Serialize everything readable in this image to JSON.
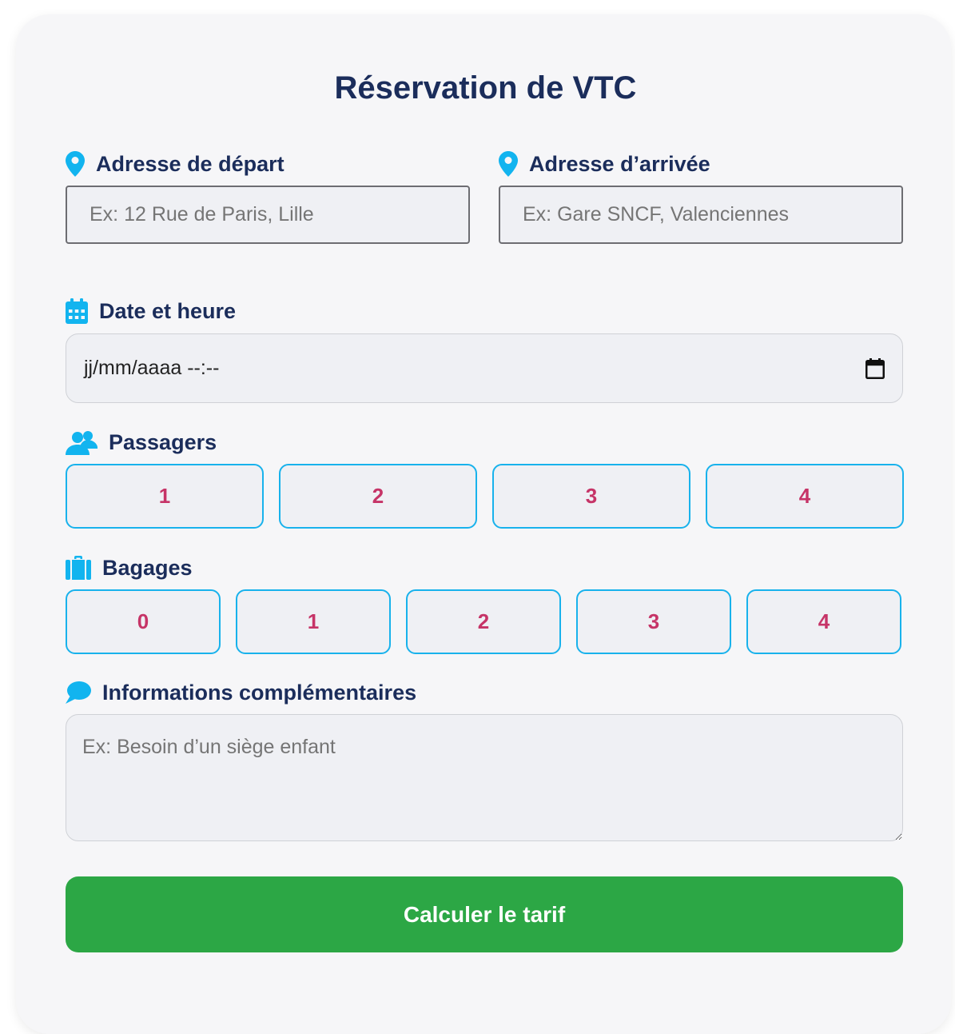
{
  "form": {
    "title": "Réservation de VTC",
    "departure": {
      "label": "Adresse de départ",
      "placeholder": "Ex: 12 Rue de Paris, Lille",
      "value": ""
    },
    "arrival": {
      "label": "Adresse d’arrivée",
      "placeholder": "Ex: Gare SNCF, Valenciennes",
      "value": ""
    },
    "datetime": {
      "label": "Date et heure",
      "value": "jj/mm/aaaa --:--"
    },
    "passengers": {
      "label": "Passagers",
      "options": [
        "1",
        "2",
        "3",
        "4"
      ]
    },
    "luggage": {
      "label": "Bagages",
      "options": [
        "0",
        "1",
        "2",
        "3",
        "4"
      ]
    },
    "info": {
      "label": "Informations complémentaires",
      "placeholder": "Ex: Besoin d’un siège enfant",
      "value": ""
    },
    "submit_label": "Calculer le tarif"
  },
  "colors": {
    "title": "#1b2d5b",
    "icon": "#12b4ef",
    "option_border": "#18b2ec",
    "option_text": "#c63467",
    "submit_bg": "#2ca745"
  },
  "icons": {
    "departure": "map-pin-icon",
    "arrival": "map-pin-icon",
    "datetime": "calendar-icon",
    "datetime_picker": "calendar-picker-icon",
    "passengers": "users-icon",
    "luggage": "suitcase-icon",
    "info": "comment-icon"
  }
}
